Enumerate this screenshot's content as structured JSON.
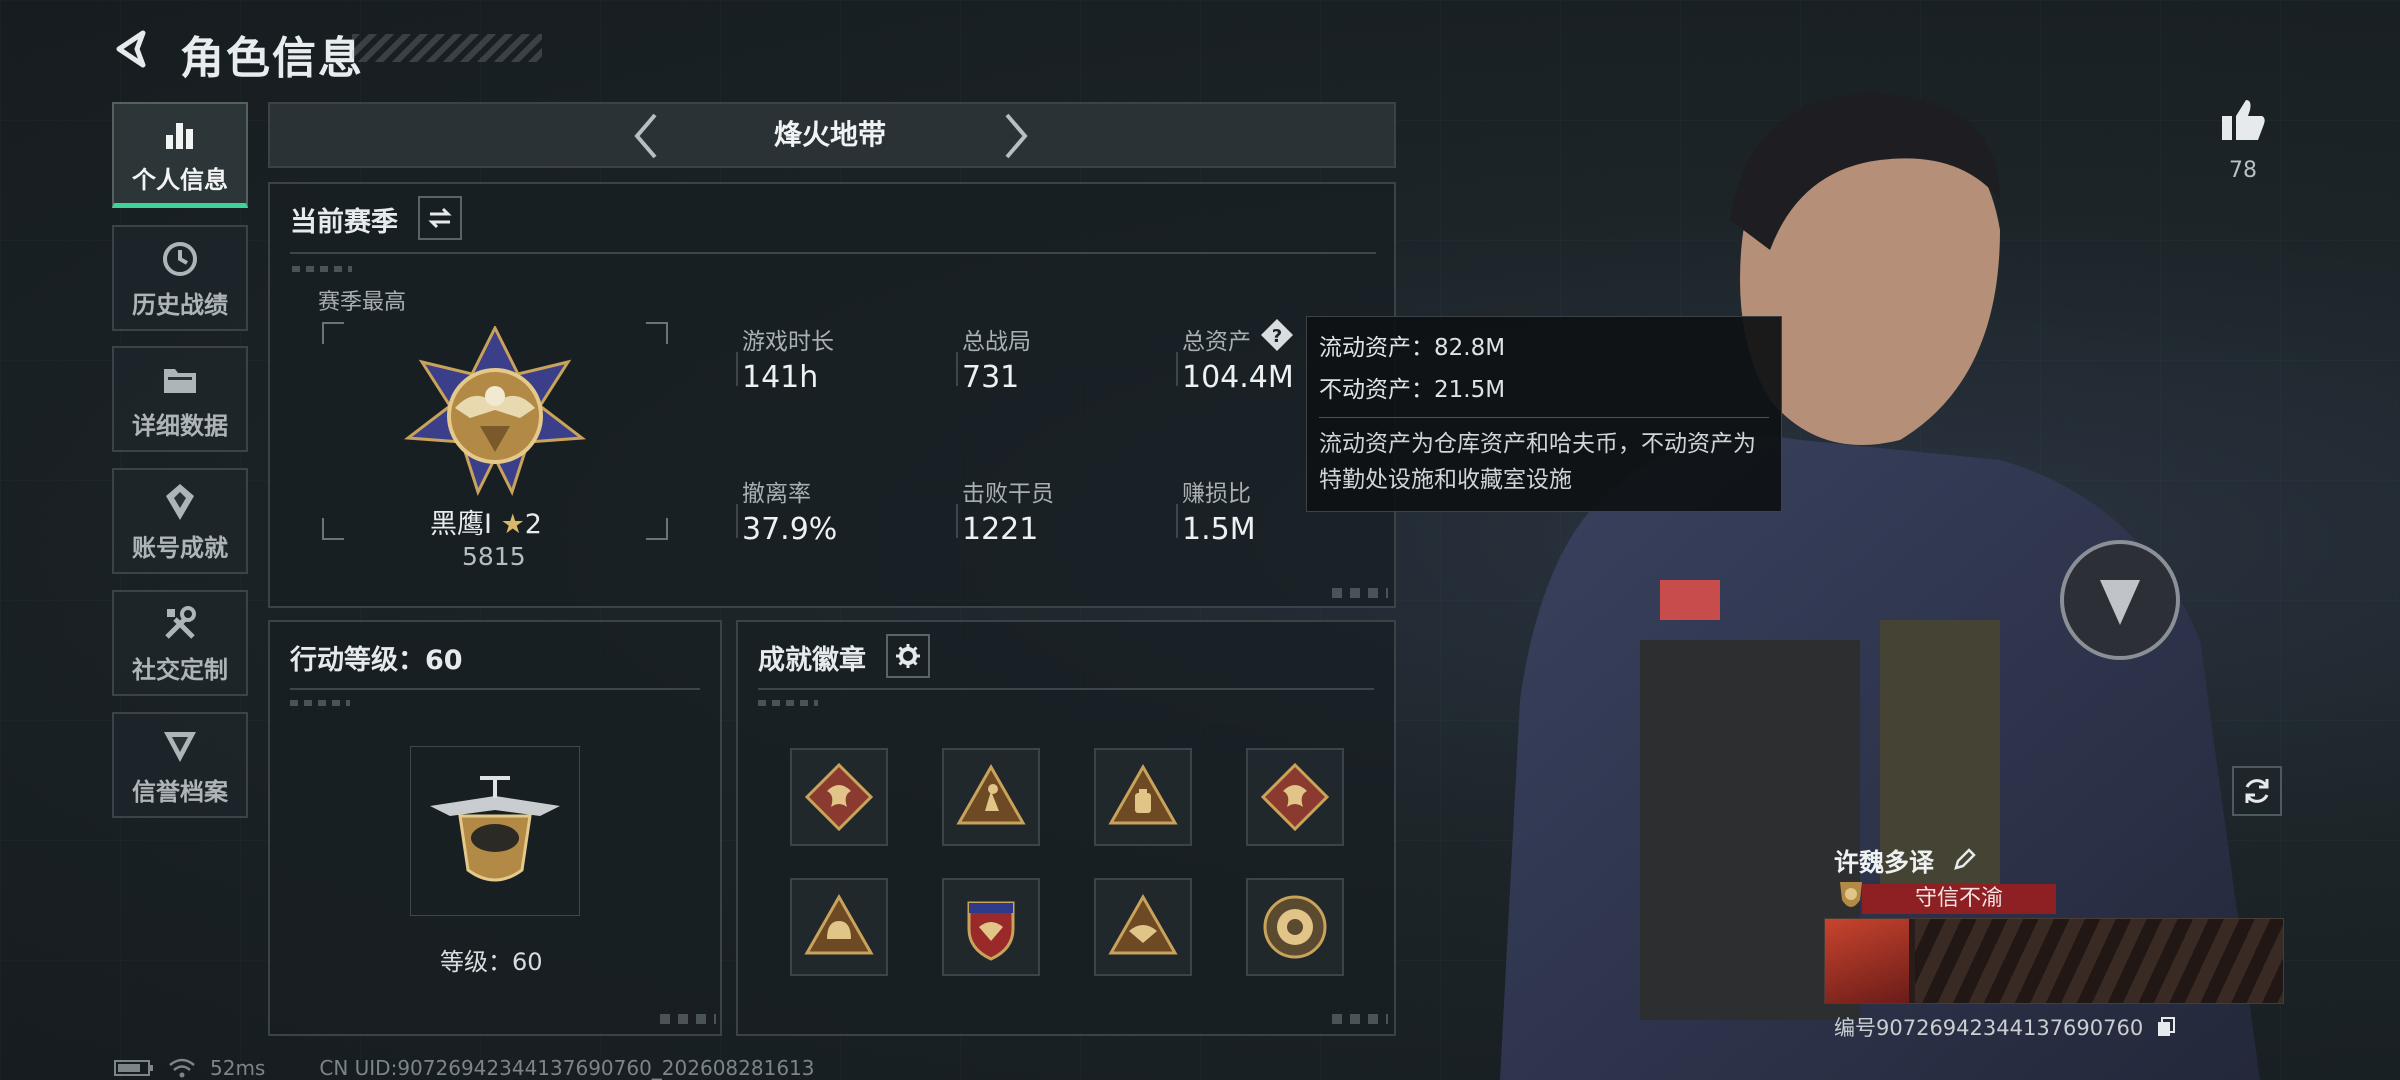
{
  "header": {
    "title": "角色信息"
  },
  "sidebar": {
    "items": [
      {
        "label": "个人信息",
        "icon": "bar-chart-icon",
        "active": true
      },
      {
        "label": "历史战绩",
        "icon": "history-clock-icon",
        "active": false
      },
      {
        "label": "详细数据",
        "icon": "folder-icon",
        "active": false
      },
      {
        "label": "账号成就",
        "icon": "achievement-icon",
        "active": false
      },
      {
        "label": "社交定制",
        "icon": "tools-icon",
        "active": false
      },
      {
        "label": "信誉档案",
        "icon": "shield-emblem-icon",
        "active": false
      }
    ]
  },
  "mode_tab": {
    "title": "烽火地带"
  },
  "season": {
    "title": "当前赛季",
    "best_label": "赛季最高",
    "rank_name": "黑鹰I",
    "rank_stars": "2",
    "rank_points": "5815",
    "stats": [
      {
        "label": "游戏时长",
        "value": "141h"
      },
      {
        "label": "总战局",
        "value": "731"
      },
      {
        "label": "总资产",
        "value": "104.4M"
      },
      {
        "label": "撤离率",
        "value": "37.9%"
      },
      {
        "label": "击败干员",
        "value": "1221"
      },
      {
        "label": "赚损比",
        "value": "1.5M"
      }
    ]
  },
  "tooltip": {
    "liquid": "流动资产：82.8M",
    "fixed": "不动资产：21.5M",
    "desc": "流动资产为仓库资产和哈夫币，不动资产为特勤处设施和收藏室设施"
  },
  "action_level": {
    "title": "行动等级：60",
    "level_label": "等级：60"
  },
  "badges": {
    "title": "成就徽章",
    "items": [
      "dragon-badge-icon",
      "triangle-figure-badge-icon",
      "triangle-backpack-badge-icon",
      "dragon-badge-icon",
      "triangle-helmet-badge-icon",
      "shield-eagle-badge-icon",
      "triangle-eagle-badge-icon",
      "round-emblem-badge-icon"
    ]
  },
  "character": {
    "likes": "78",
    "name": "许魏多译",
    "title": "守信不渝",
    "uid": "编号9072694234413769076​0"
  },
  "status": {
    "ping": "52ms",
    "uid_line": "CN UID:90726942344137690760_202608281613"
  },
  "colors": {
    "accent": "#3fd39a",
    "title_badge": "#8e1f22",
    "gold": "#c9a35a"
  }
}
